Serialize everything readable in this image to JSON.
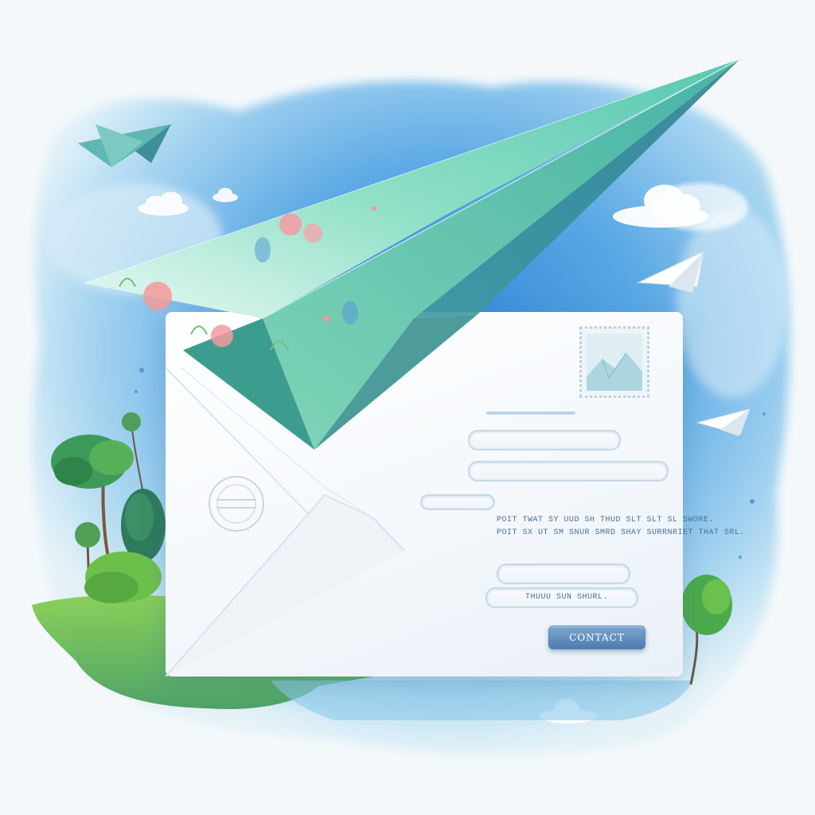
{
  "contact_form": {
    "message_line_1": "POIT TWAT SY UUD SH THUD SLT SLT SL SWORE.",
    "message_line_2": "POIT SX UT SM SNUR SMRD SHAY SURRNRIET THAT SRL.",
    "small_label": "THUUU SUN SHURL.",
    "submit_label": "CONTACT"
  },
  "colors": {
    "sky": "#7fbde6",
    "plane_green": "#6fd0ba",
    "grass": "#6cb84a",
    "button": "#4d7cae"
  },
  "icons": {
    "main": "paper-plane-icon",
    "stamp": "postage-stamp-icon",
    "postmark": "postmark-icon"
  }
}
